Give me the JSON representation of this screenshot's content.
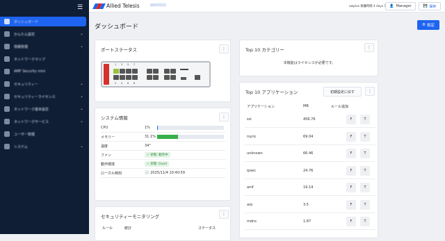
{
  "app": {
    "brand": "Allied Telesis",
    "hostname": "AR4050S",
    "status": "awplus 稼働時間 4 days 11:35",
    "manager_label": "Manager",
    "save_label": "保存"
  },
  "sidebar": {
    "items": [
      {
        "label": "ダッシュボード",
        "chev": ""
      },
      {
        "label": "かんたん設定",
        "chev": "⌄"
      },
      {
        "label": "情報管理",
        "chev": "⌄"
      },
      {
        "label": "ネットワークマップ",
        "chev": ""
      },
      {
        "label": "AMF Security mini",
        "chev": ""
      },
      {
        "label": "セキュリティー",
        "chev": "⌄"
      },
      {
        "label": "セキュリティーライセンス",
        "chev": "⌄"
      },
      {
        "label": "ネットワーク基本設定",
        "chev": "⌄"
      },
      {
        "label": "ネットワークサービス",
        "chev": "⌄"
      },
      {
        "label": "ユーザー管理",
        "chev": ""
      },
      {
        "label": "システム",
        "chev": "⌄"
      }
    ]
  },
  "page": {
    "title": "ダッシュボード",
    "settings_label": "設定"
  },
  "port_status": {
    "title": "ポートステータス",
    "top_numbers": [
      "1",
      "3",
      "5",
      "7"
    ],
    "bottom_numbers": [
      "2",
      "4",
      "6",
      "8"
    ]
  },
  "system_info": {
    "title": "システム情報",
    "rows": [
      {
        "key": "CPU",
        "value": "1%"
      },
      {
        "key": "メモリー",
        "value": "31.1%"
      },
      {
        "key": "温度",
        "value": "34°"
      },
      {
        "key": "ファン",
        "value": "✓ 状態: 動作中"
      },
      {
        "key": "動作環境",
        "value": "✓ 状態: Good"
      },
      {
        "key": "ローカル時刻",
        "value": "2025/11/4 10:40:59"
      }
    ],
    "cpu_fraction": 0.01,
    "memory_fraction": 0.311
  },
  "security_monitoring": {
    "title": "セキュリティーモニタリング",
    "headers": [
      "ルール",
      "統計",
      "ステータス"
    ]
  },
  "top_categories": {
    "title": "Top 10 カテゴリー",
    "message": "本機能はライセンスが必要です。"
  },
  "top_apps": {
    "title": "Top 10 アプリケーション",
    "reset_label": "初期設定に戻す",
    "headers": [
      "アプリケーション",
      "MB",
      "ルール追加"
    ],
    "rows": [
      {
        "name": "ssl",
        "mb": "456.76",
        "f": "F",
        "t": "T"
      },
      {
        "name": "rsync",
        "mb": "69.04",
        "f": "F",
        "t": "T"
      },
      {
        "name": "unknown",
        "mb": "66.46",
        "f": "F",
        "t": "T"
      },
      {
        "name": "ipsec",
        "mb": "24.76",
        "f": "F",
        "t": "T"
      },
      {
        "name": "amf",
        "mb": "19.14",
        "f": "F",
        "t": "T"
      },
      {
        "name": "arp",
        "mb": "3.5",
        "f": "F",
        "t": "T"
      },
      {
        "name": "mdns",
        "mb": "1.87",
        "f": "F",
        "t": "T"
      }
    ]
  },
  "colors": {
    "sidebar": "#0f1d35",
    "accent": "#1e64f0",
    "port_up": "#9bc23c",
    "bar": "#36b04a"
  }
}
